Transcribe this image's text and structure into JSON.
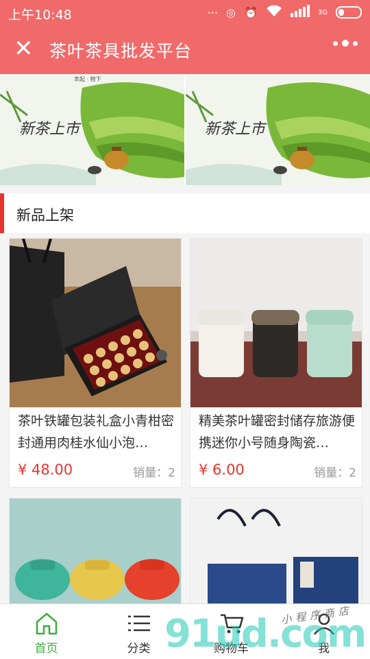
{
  "status_bar": {
    "time": "上午10:48",
    "network": "3G"
  },
  "nav": {
    "title": "茶叶茶具批发平台"
  },
  "banner": {
    "heading": "新茶上市",
    "small_text": "幸起 · 物下"
  },
  "section": {
    "title": "新品上架"
  },
  "products": [
    {
      "name": "茶叶铁罐包装礼盒小青柑密封通用肉桂水仙小泡…",
      "price": "¥ 48.00",
      "sales": "销量：2"
    },
    {
      "name": "精美茶叶罐密封储存旅游便携迷你小号随身陶瓷…",
      "price": "¥ 6.00",
      "sales": "销量：2"
    },
    {
      "name": "",
      "price": "",
      "sales": ""
    },
    {
      "name": "",
      "price": "",
      "sales": ""
    }
  ],
  "tabbar": {
    "items": [
      {
        "label": "首页",
        "icon": "home-icon",
        "active": true
      },
      {
        "label": "分类",
        "icon": "list-icon",
        "active": false
      },
      {
        "label": "购物车",
        "icon": "cart-icon",
        "active": false
      },
      {
        "label": "我",
        "icon": "user-icon",
        "active": false
      }
    ]
  },
  "watermark": {
    "text": "91ud.com",
    "handwriting": "小程序商店"
  },
  "colors": {
    "header": "#f06a6a",
    "price": "#e8342e",
    "active_tab": "#3bab3b"
  }
}
